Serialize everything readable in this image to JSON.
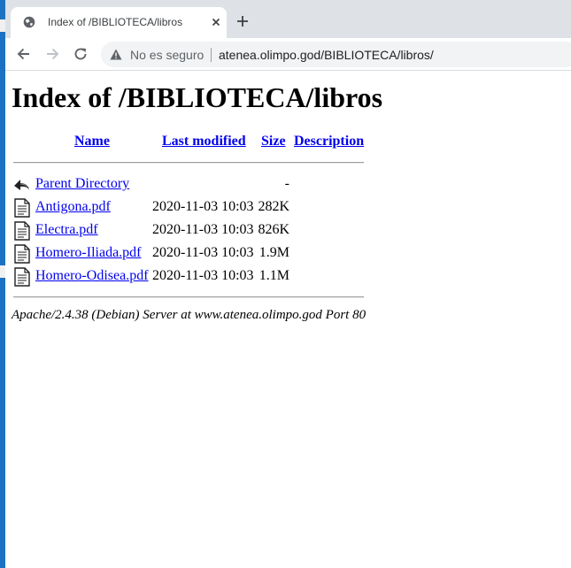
{
  "browser": {
    "tab": {
      "title": "Index of /BIBLIOTECA/libros"
    },
    "address_bar": {
      "security_text": "No es seguro",
      "url": "atenea.olimpo.god/BIBLIOTECA/libros/"
    }
  },
  "page": {
    "heading": "Index of /BIBLIOTECA/libros",
    "columns": {
      "name": "Name",
      "last_modified": "Last modified",
      "size": "Size",
      "description": "Description"
    },
    "parent": {
      "name": "Parent Directory",
      "size": "-",
      "icon": "back-arrow-icon"
    },
    "files": [
      {
        "name": "Antigona.pdf",
        "modified": "2020-11-03 10:03",
        "size": "282K",
        "icon": "document-icon"
      },
      {
        "name": "Electra.pdf",
        "modified": "2020-11-03 10:03",
        "size": "826K",
        "icon": "document-icon"
      },
      {
        "name": "Homero-Iliada.pdf",
        "modified": "2020-11-03 10:03",
        "size": "1.9M",
        "icon": "document-icon"
      },
      {
        "name": "Homero-Odisea.pdf",
        "modified": "2020-11-03 10:03",
        "size": "1.1M",
        "icon": "document-icon"
      }
    ],
    "server_signature": "Apache/2.4.38 (Debian) Server at www.atenea.olimpo.god Port 80"
  }
}
